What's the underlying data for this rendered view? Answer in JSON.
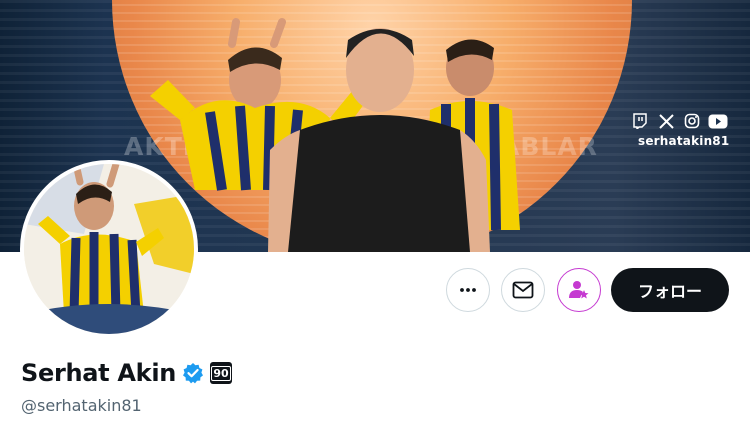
{
  "banner": {
    "handle_text": "serhatakin81",
    "wall_text_left": "AKTIVERI",
    "wall_text_right": "ABLAR",
    "social_icons": [
      "twitch-icon",
      "x-icon",
      "instagram-icon",
      "youtube-icon"
    ],
    "colors": {
      "glow": "#f7ae6b",
      "navy": "#1c3350"
    }
  },
  "profile": {
    "display_name": "Serhat Akin",
    "handle": "@serhatakin81",
    "verified": true,
    "affiliate_badge_text": "90"
  },
  "actions": {
    "more_icon": "more-icon",
    "message_icon": "envelope-icon",
    "subscribe_icon": "person-star-icon",
    "follow_label": "フォロー"
  },
  "colors": {
    "text_primary": "#0f1419",
    "text_secondary": "#536471",
    "verified_blue": "#1d9bf0",
    "subscribe_magenta": "#c53ad1",
    "button_border": "#cfd9de"
  }
}
